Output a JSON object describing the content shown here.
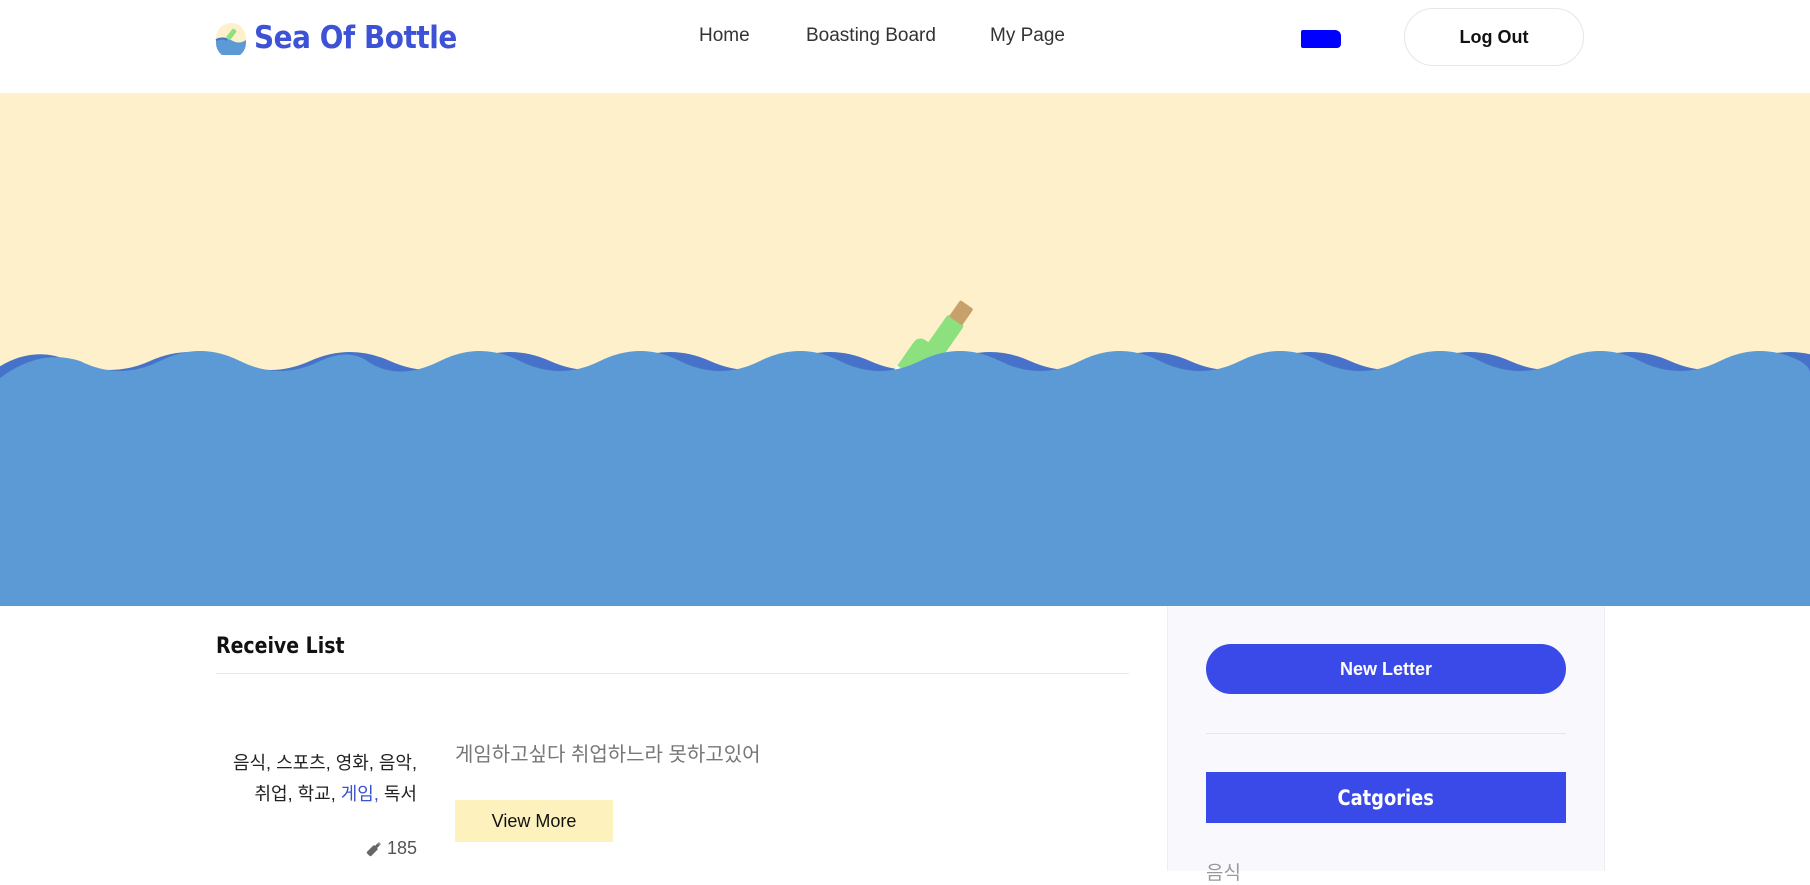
{
  "header": {
    "logo_text": "Sea Of Bottle",
    "nav": [
      {
        "label": "Home"
      },
      {
        "label": "Boasting Board"
      },
      {
        "label": "My Page"
      }
    ],
    "logout_label": "Log Out"
  },
  "colors": {
    "brand": "#3d52d5",
    "primary_button": "#3a4ae8",
    "hero_sky": "#fdf0ca",
    "sea": "#5b9ad5",
    "wave_dark": "#4673c9",
    "bottle": "#8de07e",
    "view_more_bg": "#fdf2bd",
    "redaction": "#0000ff"
  },
  "receive": {
    "title": "Receive List",
    "letter": {
      "tags_line1": [
        {
          "text": "음식, ",
          "active": false
        },
        {
          "text": "스포츠, ",
          "active": false
        },
        {
          "text": "영화, ",
          "active": false
        },
        {
          "text": "음악,",
          "active": false
        }
      ],
      "tags_line2": [
        {
          "text": "취업, ",
          "active": false
        },
        {
          "text": "학교, ",
          "active": false
        },
        {
          "text": "게임, ",
          "active": true
        },
        {
          "text": "독서",
          "active": false
        }
      ],
      "preview": "게임하고싶다 취업하느라 못하고있어",
      "view_more_label": "View More",
      "count": "185"
    }
  },
  "sidebar": {
    "new_letter_label": "New Letter",
    "categories_title": "Catgories",
    "first_category": "음식"
  }
}
